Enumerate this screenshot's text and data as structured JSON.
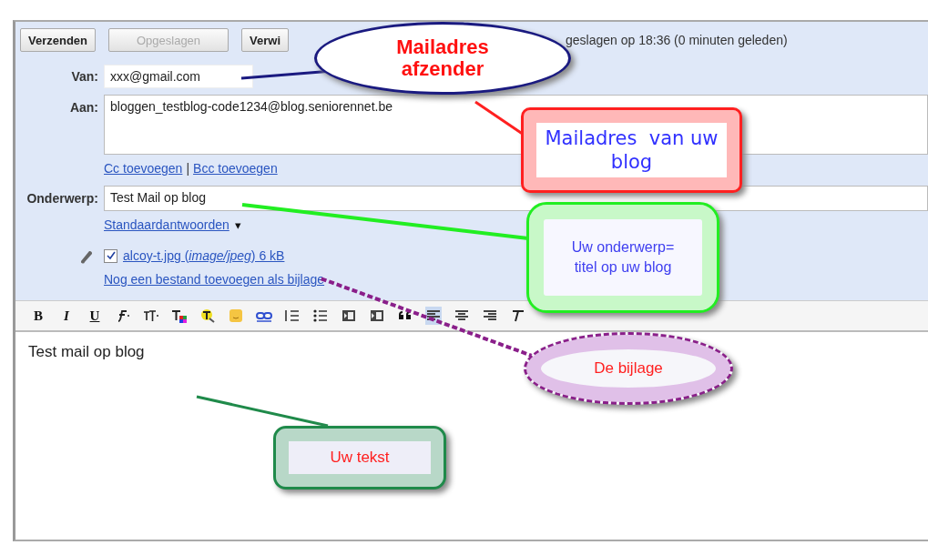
{
  "action_buttons": [
    {
      "label": "Verzenden",
      "disabled": false
    },
    {
      "label": "Opgeslagen",
      "disabled": true
    },
    {
      "label": "Verwi",
      "disabled": false
    }
  ],
  "save_status": "geslagen op 18:36 (0 minuten geleden)",
  "from": {
    "label": "Van:",
    "value": "xxx@gmail.com"
  },
  "to": {
    "label": "Aan:",
    "value": "bloggen_testblog-code1234@blog.seniorennet.be"
  },
  "cc_links": [
    "Cc toevoegen",
    "Bcc toevoegen"
  ],
  "cc_separator": "|",
  "subject": {
    "label": "Onderwerp:",
    "value": "Test Mail op blog"
  },
  "canned_responses": {
    "label": "Standaardantwoorden",
    "caret": "▾"
  },
  "attachment": {
    "checked": true,
    "label": "alcoy-t.jpg (*image/jpeg*) 6 kB"
  },
  "add_attachment": "Nog een bestand toevoegen als bijlage",
  "format_toolbar": [
    {
      "kind": "bold",
      "glyph": "B",
      "selected": false
    },
    {
      "kind": "italic",
      "glyph": "I",
      "selected": false
    },
    {
      "kind": "underline",
      "glyph": "U",
      "selected": false
    },
    {
      "kind": "font",
      "selected": false
    },
    {
      "kind": "size",
      "selected": false
    },
    {
      "kind": "textcolor",
      "selected": false
    },
    {
      "kind": "highlight",
      "selected": false
    },
    {
      "kind": "smiley",
      "selected": false
    },
    {
      "kind": "link",
      "selected": false
    },
    {
      "kind": "numbered",
      "selected": false
    },
    {
      "kind": "bullets",
      "selected": false
    },
    {
      "kind": "outdent",
      "selected": false
    },
    {
      "kind": "indent",
      "selected": false
    },
    {
      "kind": "quote",
      "selected": false
    },
    {
      "kind": "alignleft",
      "selected": true
    },
    {
      "kind": "aligncenter",
      "selected": false
    },
    {
      "kind": "alignright",
      "selected": false
    },
    {
      "kind": "clearformat",
      "selected": false
    }
  ],
  "body": "Test mail op blog",
  "annotations": [
    {
      "kind": "oval",
      "text": "Mailadres afzender"
    },
    {
      "kind": "redbox",
      "text": "Mailadres  van uw blog"
    },
    {
      "kind": "greenbox",
      "text": "Uw onderwerp=titel op uw blog"
    },
    {
      "kind": "dashedoval",
      "text": "De bijlage"
    },
    {
      "kind": "tealbox",
      "text": "Uw tekst"
    }
  ]
}
